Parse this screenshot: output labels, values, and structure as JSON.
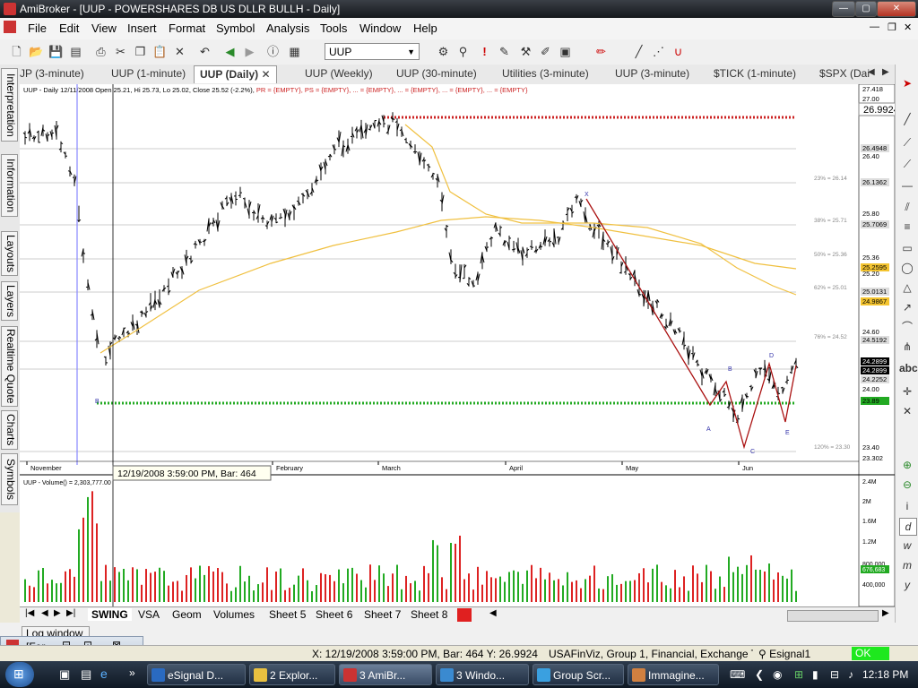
{
  "window": {
    "title": "AmiBroker - [UUP - POWERSHARES DB US DLLR BULLH - Daily]"
  },
  "menu": [
    "File",
    "Edit",
    "View",
    "Insert",
    "Format",
    "Symbol",
    "Analysis",
    "Tools",
    "Window",
    "Help"
  ],
  "toolbar": {
    "symbol": "UUP"
  },
  "tabs": [
    {
      "label": "JP (3-minute)"
    },
    {
      "label": "UUP (1-minute)"
    },
    {
      "label": "UUP (Daily)",
      "active": true
    },
    {
      "label": "UUP (Weekly)"
    },
    {
      "label": "UUP (30-minute)"
    },
    {
      "label": "Utilities (3-minute)"
    },
    {
      "label": "UUP (3-minute)"
    },
    {
      "label": "$TICK (1-minute)"
    },
    {
      "label": "$SPX (Dai"
    }
  ],
  "left_tabs": [
    "Interpretation",
    "Information",
    "Layouts",
    "Layers",
    "Realtime Quote",
    "Charts",
    "Symbols"
  ],
  "chart": {
    "header": "UUP - Daily 12/11/2008 Open 25.21, Hi 25.73, Lo 25.02, Close 25.52 (-2.2%)",
    "header_tail": "PR = {EMPTY}, PS = {EMPTY}, ... = {EMPTY}, ... = {EMPTY}, ... = {EMPTY}, ... = {EMPTY}",
    "tooltip": "12/19/2008 3:59:00 PM, Bar: 464",
    "crosshair_value": "26.9924",
    "price_labels": [
      {
        "text": "27.418",
        "bg": ""
      },
      {
        "text": "27.00",
        "bg": ""
      },
      {
        "text": "26.4948",
        "bg": "#dddddd"
      },
      {
        "text": "26.40",
        "bg": ""
      },
      {
        "text": "26.1362",
        "bg": "#dddddd"
      },
      {
        "text": "25.80",
        "bg": ""
      },
      {
        "text": "25.7069",
        "bg": "#dddddd"
      },
      {
        "text": "25.36",
        "bg": ""
      },
      {
        "text": "25.2595",
        "bg": "#f4c430"
      },
      {
        "text": "25.20",
        "bg": ""
      },
      {
        "text": "25.0131",
        "bg": "#dddddd"
      },
      {
        "text": "24.9867",
        "bg": "#f4c430"
      },
      {
        "text": "24.60",
        "bg": ""
      },
      {
        "text": "24.5192",
        "bg": "#dddddd"
      },
      {
        "text": "24.2899",
        "bg": "#000000"
      },
      {
        "text": "24.2899",
        "bg": "#000000"
      },
      {
        "text": "24.2252",
        "bg": "#dddddd"
      },
      {
        "text": "24.00",
        "bg": ""
      },
      {
        "text": "23.89",
        "bg": "#22aa22"
      },
      {
        "text": "23.40",
        "bg": ""
      },
      {
        "text": "23.302",
        "bg": ""
      }
    ],
    "fib_labels": [
      "23% = 26.14",
      "38% = 25.71",
      "50% = 25.36",
      "62% = 25.01",
      "76% = 24.52",
      "120% = 23.30"
    ],
    "months": [
      "November",
      "February",
      "March",
      "April",
      "May",
      "Jun"
    ],
    "pattern_labels": [
      "X",
      "A",
      "B",
      "C",
      "D",
      "E",
      "B"
    ],
    "volume_header": "UUP - Volume() = 2,303,777.00",
    "volume_labels": [
      "2.4M",
      "2M",
      "1.6M",
      "1.2M",
      "800,000",
      "676,683",
      "400,000"
    ]
  },
  "sheets": [
    "SWING",
    "VSA",
    "Geom",
    "Volumes",
    "Sheet 5",
    "Sheet 6",
    "Sheet 7",
    "Sheet 8"
  ],
  "log_window": "Log window",
  "mini_window": "[For...",
  "status": {
    "coords": "X: 12/19/2008 3:59:00 PM, Bar: 464  Y: 26.9924",
    "info": "USAFinViz, Group 1, Financial, Exchange Tr",
    "source": "Esignal1",
    "ok": "OK"
  },
  "taskbar": {
    "tasks": [
      "eSignal D...",
      "2 Explor...",
      "3 AmiBr...",
      "3 Windo...",
      "Group Scr...",
      "Immagine..."
    ],
    "clock": "12:18 PM"
  },
  "colors": {
    "up": "#22aa22",
    "down": "#dd2222",
    "ma": "#f0c040",
    "fibline": "#bbbbbb"
  }
}
